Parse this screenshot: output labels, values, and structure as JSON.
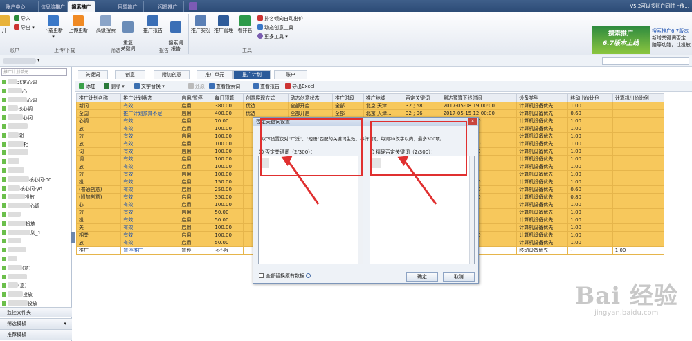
{
  "top_tabs": [
    "账户中心",
    "信息流推广",
    "搜索推广",
    "网盟推广",
    "闪投推广"
  ],
  "active_top_tab": "搜索推广",
  "version_text": "V5.2可以多账户同时上传...",
  "ribbon": {
    "import_label": "导入",
    "export_label": "导出",
    "open_label": "开",
    "download_update": "下载更新",
    "upload_update": "上传更新",
    "advanced_search": "高级搜索",
    "restore_keyword": "重复\n关键词",
    "promo_report": "推广报告",
    "search_word_report": "搜索词\n报告",
    "promo_practice": "推广实况",
    "promo_manage": "推广管理",
    "watch_rank": "看排名",
    "rank_auto_bid": "排名倾向自动出价",
    "dynamic_creative": "动态创意工具",
    "more_tools": "更多工具",
    "groups": [
      "账户",
      "上传/下载",
      "筛选",
      "报告",
      "工具"
    ]
  },
  "ad": {
    "line1": "搜索推广",
    "line2": "6.7版本上线",
    "side_title": "搜索推广6.7版本",
    "side_text1": "新增关键词否定",
    "side_text2": "赔等功能，让投放"
  },
  "left_panel": {
    "search_placeholder": "推广计划单元",
    "items": [
      "北京心调",
      "心",
      "心调",
      "核心调",
      "心词",
      "",
      "湖",
      "相",
      "",
      "",
      "",
      "核心词-pc",
      "核心词-yd",
      "投放",
      "心调",
      "",
      "投放",
      "划_1",
      "",
      "",
      "",
      "(意)",
      "",
      "(意)",
      "投放",
      "投放"
    ],
    "footer": [
      "监控文件夹",
      "筛选模板",
      "推荐模板"
    ]
  },
  "main_tabs": [
    "关键词",
    "创意",
    "附加创意",
    "推广单元",
    "推广计划",
    "账户"
  ],
  "active_main_tab": "推广计划",
  "toolbar": [
    "添加",
    "删除",
    "文字替换",
    "还原",
    "查看搜索词",
    "查看报告",
    "导出Excel"
  ],
  "grid": {
    "headers": [
      "推广计划名称",
      "推广计划状态",
      "启用/暂停",
      "每日预算",
      "创意展现方式",
      "动态创意状态",
      "推广时段",
      "推广地域",
      "否定关键词",
      "到达预算下线时间",
      "设备类型",
      "移动出价比例",
      "计算机出价比例"
    ],
    "rows": [
      [
        "新词",
        "有效",
        "启用",
        "380.00",
        "优选",
        "全部开启",
        "全部",
        "北京 天津...",
        "32 ; 58",
        "2017-05-08 19:00:00",
        "计算机设备优先",
        "1.00",
        ""
      ],
      [
        "全国",
        "推广计划预算不足",
        "启用",
        "400.00",
        "优选",
        "全部开启",
        "全部",
        "北京 天津...",
        "32 ; 96",
        "2017-05-15 12:00:00",
        "计算机设备优先",
        "0.60",
        ""
      ],
      [
        "心调",
        "有效",
        "启用",
        "70.00",
        "",
        "",
        "",
        "",
        "",
        "04-19 21:00:00",
        "计算机设备优先",
        "1.00",
        ""
      ],
      [
        "放",
        "有效",
        "启用",
        "100.00",
        "",
        "",
        "",
        "",
        "",
        "",
        "计算机设备优先",
        "1.00",
        ""
      ],
      [
        "放",
        "有效",
        "启用",
        "100.00",
        "",
        "",
        "",
        "",
        "",
        "",
        "计算机设备优先",
        "1.00",
        ""
      ],
      [
        "放",
        "有效",
        "启用",
        "100.00",
        "",
        "",
        "",
        "",
        "",
        "04-19 18:00:00",
        "计算机设备优先",
        "1.00",
        ""
      ],
      [
        "词",
        "有效",
        "启用",
        "100.00",
        "",
        "",
        "",
        "",
        "",
        "04-19 16:00:00",
        "计算机设备优先",
        "1.00",
        ""
      ],
      [
        "调",
        "有效",
        "启用",
        "100.00",
        "",
        "",
        "",
        "",
        "",
        "",
        "计算机设备优先",
        "1.00",
        ""
      ],
      [
        "放",
        "有效",
        "启用",
        "100.00",
        "",
        "",
        "",
        "",
        "",
        "",
        "计算机设备优先",
        "1.00",
        ""
      ],
      [
        "放",
        "有效",
        "启用",
        "100.00",
        "",
        "",
        "",
        "",
        "",
        "",
        "计算机设备优先",
        "1.00",
        ""
      ],
      [
        "投",
        "有效",
        "启用",
        "150.00",
        "",
        "",
        "",
        "",
        "",
        "05-09 21:00:00",
        "计算机设备优先",
        "1.00",
        ""
      ],
      [
        "(普通创意)",
        "有效",
        "启用",
        "250.00",
        "",
        "",
        "",
        "",
        "",
        "04-29 17:00:00",
        "计算机设备优先",
        "0.60",
        ""
      ],
      [
        "(附加创意)",
        "有效",
        "启用",
        "350.00",
        "",
        "",
        "",
        "",
        "",
        "05-01 17:00:00",
        "计算机设备优先",
        "0.80",
        ""
      ],
      [
        "心",
        "有效",
        "启用",
        "100.00",
        "",
        "",
        "",
        "",
        "",
        "",
        "计算机设备优先",
        "1.00",
        ""
      ],
      [
        "放",
        "有效",
        "启用",
        "50.00",
        "",
        "",
        "",
        "",
        "",
        "",
        "计算机设备优先",
        "1.00",
        ""
      ],
      [
        "投",
        "有效",
        "启用",
        "50.00",
        "",
        "",
        "",
        "",
        "",
        "",
        "计算机设备优先",
        "1.00",
        ""
      ],
      [
        "关",
        "有效",
        "启用",
        "100.00",
        "",
        "",
        "",
        "",
        "",
        "",
        "计算机设备优先",
        "1.00",
        ""
      ],
      [
        "相关",
        "有效",
        "启用",
        "100.00",
        "",
        "",
        "",
        "",
        "",
        "04-26 15:00:00",
        "计算机设备优先",
        "1.00",
        ""
      ],
      [
        "放",
        "有效",
        "启用",
        "50.00",
        "",
        "",
        "",
        "",
        "",
        "",
        "计算机设备优先",
        "1.00",
        ""
      ],
      [
        "推广",
        "暂停推广",
        "暂停",
        "<不限",
        "",
        "",
        "",
        "",
        "",
        "",
        "移动设备优先",
        "-",
        "1.00"
      ]
    ]
  },
  "dialog": {
    "title": "否定关键词设置",
    "close": "×",
    "description": "以下设置仅对\"广泛\"、\"短语\"匹配的关键词生效，每行1词，每词20汉字以内，最多300项。",
    "left_label": "否定关键词（2/300）：",
    "right_label": "精确否定关键词（2/300）：",
    "checkbox_label": "全部替换原有数据",
    "ok": "确定",
    "cancel": "取消"
  },
  "watermark": {
    "line1": "Bai 经验",
    "line2": "jingyan.baidu.com"
  },
  "colors": {
    "row_highlight": "#f7c85c",
    "active_tab": "#2b5b9a",
    "annotation_red": "#e03030"
  }
}
